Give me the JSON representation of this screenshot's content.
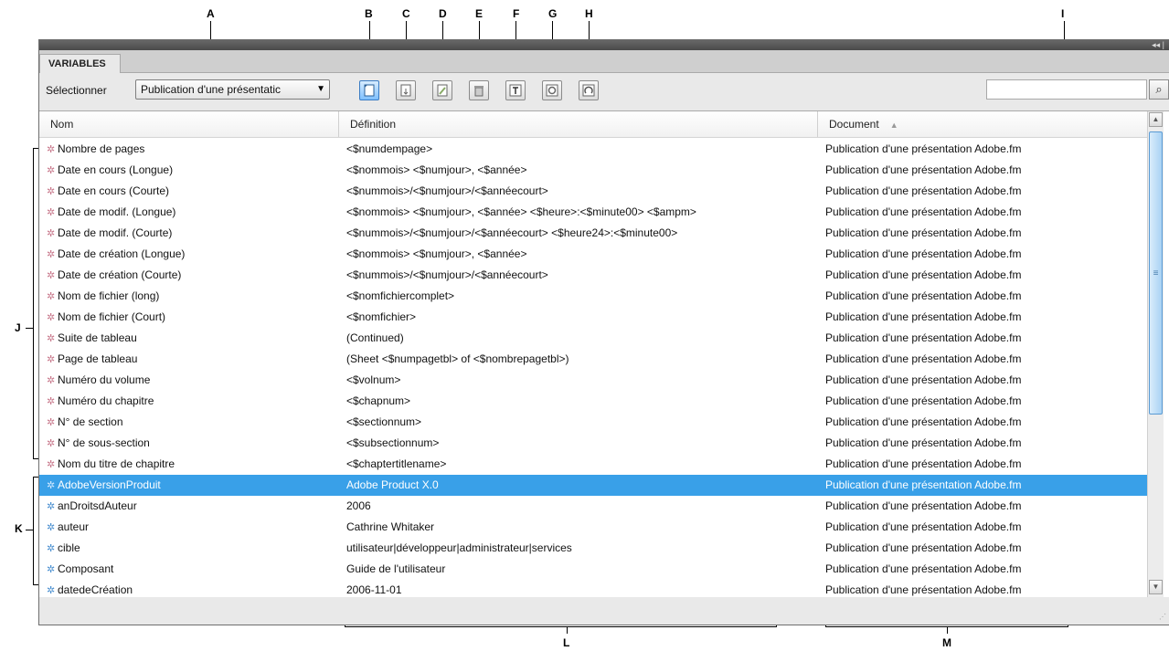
{
  "callouts": {
    "A": "A",
    "B": "B",
    "C": "C",
    "D": "D",
    "E": "E",
    "F": "F",
    "G": "G",
    "H": "H",
    "I": "I",
    "J": "J",
    "K": "K",
    "L": "L",
    "M": "M"
  },
  "panel": {
    "tab_label": "VARIABLES",
    "select_label": "Sélectionner",
    "dropdown_value": "Publication d'une présentatic",
    "search_placeholder": ""
  },
  "toolbar_icons": [
    "new-variable-icon",
    "import-variables-icon",
    "edit-variable-icon",
    "delete-variable-icon",
    "convert-to-text-icon",
    "update-variables-icon",
    "reset-icon"
  ],
  "columns": {
    "name": "Nom",
    "definition": "Définition",
    "document": "Document"
  },
  "rows": [
    {
      "type": "system",
      "name": "Nombre de pages",
      "definition": "<$numdempage>",
      "document": "Publication d'une présentation Adobe.fm"
    },
    {
      "type": "system",
      "name": "Date en cours (Longue)",
      "definition": "<$nommois> <$numjour>, <$année>",
      "document": "Publication d'une présentation Adobe.fm"
    },
    {
      "type": "system",
      "name": "Date en cours (Courte)",
      "definition": "<$nummois>/<$numjour>/<$annéecourt>",
      "document": "Publication d'une présentation Adobe.fm"
    },
    {
      "type": "system",
      "name": "Date de modif. (Longue)",
      "definition": "<$nommois> <$numjour>, <$année> <$heure>:<$minute00> <$ampm>",
      "document": "Publication d'une présentation Adobe.fm"
    },
    {
      "type": "system",
      "name": "Date de modif. (Courte)",
      "definition": "<$nummois>/<$numjour>/<$annéecourt> <$heure24>:<$minute00>",
      "document": "Publication d'une présentation Adobe.fm"
    },
    {
      "type": "system",
      "name": "Date de création (Longue)",
      "definition": "<$nommois> <$numjour>, <$année>",
      "document": "Publication d'une présentation Adobe.fm"
    },
    {
      "type": "system",
      "name": "Date de création (Courte)",
      "definition": "<$nummois>/<$numjour>/<$annéecourt>",
      "document": "Publication d'une présentation Adobe.fm"
    },
    {
      "type": "system",
      "name": "Nom de fichier (long)",
      "definition": "<$nomfichiercomplet>",
      "document": "Publication d'une présentation Adobe.fm"
    },
    {
      "type": "system",
      "name": "Nom de fichier (Court)",
      "definition": "<$nomfichier>",
      "document": "Publication d'une présentation Adobe.fm"
    },
    {
      "type": "system",
      "name": "Suite de tableau",
      "definition": "(Continued)",
      "document": "Publication d'une présentation Adobe.fm"
    },
    {
      "type": "system",
      "name": "Page de tableau",
      "definition": "(Sheet <$numpagetbl> of <$nombrepagetbl>)",
      "document": "Publication d'une présentation Adobe.fm"
    },
    {
      "type": "system",
      "name": "Numéro du volume",
      "definition": "<$volnum>",
      "document": "Publication d'une présentation Adobe.fm"
    },
    {
      "type": "system",
      "name": "Numéro du chapitre",
      "definition": "<$chapnum>",
      "document": "Publication d'une présentation Adobe.fm"
    },
    {
      "type": "system",
      "name": "N° de section",
      "definition": "<$sectionnum>",
      "document": "Publication d'une présentation Adobe.fm"
    },
    {
      "type": "system",
      "name": "N° de sous-section",
      "definition": "<$subsectionnum>",
      "document": "Publication d'une présentation Adobe.fm"
    },
    {
      "type": "system",
      "name": "Nom du titre de chapitre",
      "definition": "<$chaptertitlename>",
      "document": "Publication d'une présentation Adobe.fm"
    },
    {
      "type": "user",
      "selected": true,
      "name": "AdobeVersionProduit",
      "definition": "Adobe Product X.0",
      "document": "Publication d'une présentation Adobe.fm"
    },
    {
      "type": "user",
      "name": "anDroitsdAuteur",
      "definition": "2006",
      "document": "Publication d'une présentation Adobe.fm"
    },
    {
      "type": "user",
      "name": "auteur",
      "definition": "Cathrine Whitaker",
      "document": "Publication d'une présentation Adobe.fm"
    },
    {
      "type": "user",
      "name": "cible",
      "definition": "utilisateur|développeur|administrateur|services",
      "document": "Publication d'une présentation Adobe.fm"
    },
    {
      "type": "user",
      "name": "Composant",
      "definition": "Guide de l'utilisateur",
      "document": "Publication d'une présentation Adobe.fm"
    },
    {
      "type": "user",
      "name": "datedeCréation",
      "definition": "2006-11-01",
      "document": "Publication d'une présentation Adobe.fm"
    }
  ],
  "colors": {
    "selection": "#39a0e8",
    "system_icon": "#c8788b",
    "user_icon": "#4a8fd0",
    "title_bar": "#4a4a4a"
  }
}
